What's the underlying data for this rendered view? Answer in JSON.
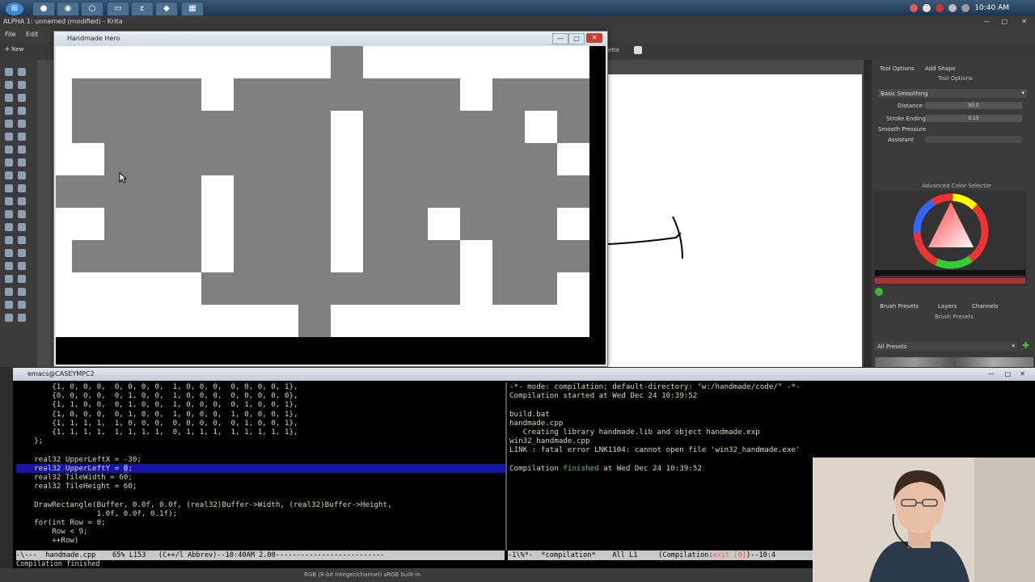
{
  "taskbar": {
    "clock": "10:40 AM",
    "apps": [
      "chrome",
      "firefox",
      "opera",
      "cmd",
      "emacs",
      "visual-studio",
      "calc"
    ]
  },
  "krita": {
    "title": "ALPHA 1: unnamed (modified) - Krita",
    "menu": [
      "File",
      "Edit"
    ],
    "toolbar_new": "New",
    "right_panel": {
      "tabs": [
        "Tool Options",
        "Add Shape"
      ],
      "subheader": "Tool Options",
      "smoothing": "Basic Smoothing",
      "distance_label": "Distance:",
      "distance_value": "50.0",
      "stroke_ending_label": "Stroke Ending:",
      "stroke_ending_value": "0.15",
      "smooth_pressure_label": "Smooth Pressure",
      "assistant_label": "Assistant",
      "color_selector_title": "Advanced Color Selector",
      "bottom_tabs": [
        "Brush Presets",
        "Layers",
        "Channels"
      ],
      "brush_presets_header": "Brush Presets",
      "all_presets": "All Presets"
    },
    "palette_label": "lette",
    "status": "RGB (8-bit integer/channel)  sRGB built-in"
  },
  "handmade": {
    "title": "Handmade Hero",
    "controls": {
      "min": "—",
      "max": "□",
      "close": "✕"
    },
    "tilemap": [
      [
        1,
        1,
        1,
        1,
        1,
        1,
        1,
        1,
        1,
        0,
        1,
        1,
        1,
        1,
        1,
        1,
        1
      ],
      [
        1,
        0,
        0,
        0,
        0,
        1,
        0,
        0,
        0,
        0,
        0,
        0,
        0,
        1,
        0,
        0,
        0
      ],
      [
        1,
        0,
        0,
        0,
        0,
        0,
        0,
        0,
        0,
        1,
        0,
        0,
        0,
        0,
        0,
        1,
        0
      ],
      [
        1,
        1,
        0,
        0,
        0,
        0,
        0,
        0,
        0,
        1,
        0,
        0,
        0,
        0,
        0,
        0,
        1
      ],
      [
        0,
        0,
        0,
        0,
        0,
        1,
        0,
        0,
        0,
        1,
        0,
        0,
        0,
        0,
        0,
        0,
        0
      ],
      [
        1,
        1,
        0,
        0,
        0,
        1,
        0,
        0,
        0,
        1,
        0,
        0,
        1,
        0,
        0,
        0,
        1
      ],
      [
        1,
        0,
        0,
        0,
        0,
        1,
        0,
        0,
        0,
        1,
        0,
        0,
        0,
        1,
        0,
        0,
        0
      ],
      [
        1,
        1,
        1,
        1,
        1,
        0,
        0,
        0,
        0,
        0,
        0,
        0,
        0,
        1,
        0,
        0,
        1
      ],
      [
        1,
        1,
        1,
        1,
        1,
        1,
        1,
        1,
        0,
        1,
        1,
        1,
        1,
        1,
        1,
        1,
        1
      ]
    ],
    "colors": {
      "wall": "#ffffff",
      "floor": "#808080",
      "background": "#000000"
    }
  },
  "emacs": {
    "title": "emacs@CASEYMPC2",
    "left_code": [
      "        {1, 0, 0, 0,  0, 0, 0, 0,  1, 0, 0, 0,  0, 0, 0, 0, 1},",
      "        {0, 0, 0, 0,  0, 1, 0, 0,  1, 0, 0, 0,  0, 0, 0, 0, 0},",
      "        {1, 1, 0, 0,  0, 1, 0, 0,  1, 0, 0, 0,  0, 1, 0, 0, 1},",
      "        {1, 0, 0, 0,  0, 1, 0, 0,  1, 0, 0, 0,  1, 0, 0, 0, 1},",
      "        {1, 1, 1, 1,  1, 0, 0, 0,  0, 0, 0, 0,  0, 1, 0, 0, 1},",
      "        {1, 1, 1, 1,  1, 1, 1, 1,  0, 1, 1, 1,  1, 1, 1, 1, 1},",
      "    };",
      "",
      "    real32 UpperLeftX = -30;",
      "    real32 UpperLeftY = ",
      "    real32 TileWidth = 60;",
      "    real32 TileHeight = 60;",
      "",
      "    DrawRectangle(Buffer, 0.0f, 0.0f, (real32)Buffer->Width, (real32)Buffer->Height,",
      "                  1.0f, 0.0f, 0.1f);",
      "    for(int Row = 0;",
      "        Row < 9;",
      "        ++Row)"
    ],
    "cursor_line_index": 9,
    "cursor_char": "0",
    "cursor_line_rest": ";",
    "right_lines": [
      "-*- mode: compilation; default-directory: \"w:/handmade/code/\" -*-",
      "Compilation started at Wed Dec 24 10:39:52",
      "",
      "build.bat",
      "handmade.cpp",
      "   Creating library handmade.lib and object handmade.exp",
      "win32_handmade.cpp",
      "LINK : fatal error LNK1104: cannot open file 'win32_handmade.exe'",
      "",
      "Compilation "
    ],
    "finished_word": "finished",
    "finished_rest": " at Wed Dec 24 10:39:52",
    "modeline_left": "-\\---  handmade.cpp    65% L153   (C++/l Abbrev)--10:40AM 2.00--------------------------",
    "modeline_right_a": "-1\\%*-  *compilation*    All L1     (Compilation:",
    "modeline_right_exit": "exit [0]",
    "modeline_right_b": ")--10:4",
    "minibuffer": "Compilation finished"
  }
}
